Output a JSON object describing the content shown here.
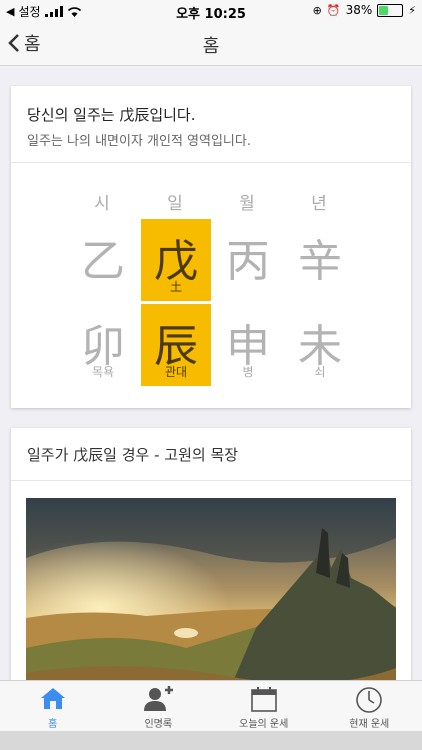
{
  "status": {
    "carrier": "설정",
    "time": "오후 10:25",
    "battery": "38%"
  },
  "nav": {
    "back_label": "홈",
    "title": "홈"
  },
  "card1": {
    "title": "당신의 일주는 戊辰입니다.",
    "subtitle": "일주는 나의 내면이자 개인적 영역입니다.",
    "columns": [
      {
        "label": "시",
        "top": "乙",
        "bottom": "卯",
        "bottom_sub": "목욕"
      },
      {
        "label": "일",
        "top": "戊",
        "top_sub": "土",
        "bottom": "辰",
        "bottom_sub": "관대"
      },
      {
        "label": "월",
        "top": "丙",
        "bottom": "申",
        "bottom_sub": "병"
      },
      {
        "label": "년",
        "top": "辛",
        "bottom": "未",
        "bottom_sub": "쇠"
      }
    ],
    "highlight_color": "#f7bb00"
  },
  "card2": {
    "title": "일주가 戊辰일 경우 - 고원의 목장"
  },
  "tabs": [
    {
      "label": "홈",
      "icon": "home-icon",
      "active": true
    },
    {
      "label": "인명록",
      "icon": "add-person-icon"
    },
    {
      "label": "오늘의 운세",
      "icon": "calendar-icon"
    },
    {
      "label": "현재 운세",
      "icon": "clock-icon"
    }
  ]
}
